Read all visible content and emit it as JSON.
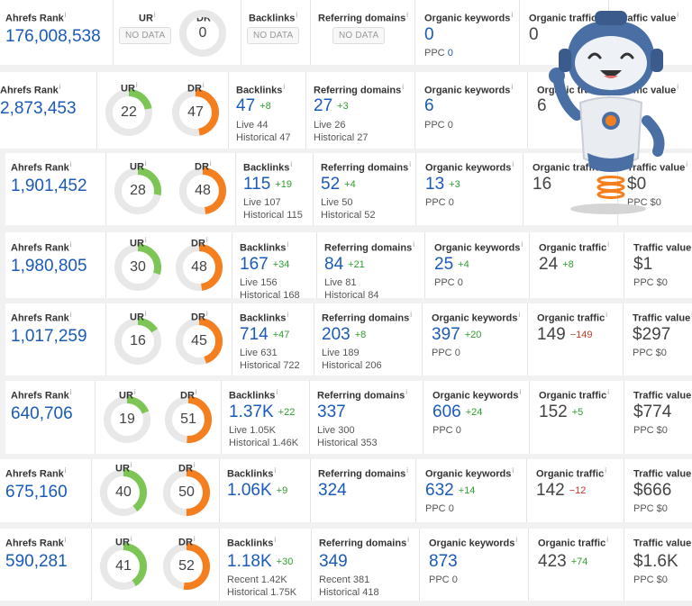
{
  "labels": {
    "ahrefs_rank": "Ahrefs Rank",
    "ur": "UR",
    "dr": "DR",
    "backlinks": "Backlinks",
    "referring_domains": "Referring domains",
    "organic_keywords": "Organic keywords",
    "organic_traffic": "Organic traffic",
    "traffic_value": "Traffic value",
    "info_mark": "i",
    "no_data": "NO DATA"
  },
  "colors": {
    "ur": "#7dc656",
    "dr": "#f57e1e",
    "track": "#e8e8e8",
    "link": "#1a5ab8",
    "positive": "#2e9e2e",
    "negative": "#c0392b"
  },
  "rows": [
    {
      "ahrefs_rank": "176,008,538",
      "ur": null,
      "dr": "0",
      "dr_value": 0,
      "backlinks": null,
      "backlinks_lines": [],
      "ref_domains": null,
      "ref_domains_lines": [],
      "organic_keywords": "0",
      "ppc": "0",
      "organic_traffic": "0",
      "traffic_value": null,
      "tv_ppc": null
    },
    {
      "ahrefs_rank": "2,873,453",
      "ur": "22",
      "ur_value": 22,
      "dr": "47",
      "dr_value": 47,
      "backlinks": "47",
      "backlinks_delta": "+8",
      "backlinks_lines": [
        "Live 44",
        "Historical 47"
      ],
      "ref_domains": "27",
      "ref_domains_delta": "+3",
      "ref_domains_lines": [
        "Live 26",
        "Historical 27"
      ],
      "organic_keywords": "6",
      "ppc": "0",
      "organic_traffic": "6",
      "traffic_value": null,
      "tv_ppc": null
    },
    {
      "ahrefs_rank": "1,901,452",
      "ur": "28",
      "ur_value": 28,
      "dr": "48",
      "dr_value": 48,
      "backlinks": "115",
      "backlinks_delta": "+19",
      "backlinks_lines": [
        "Live 107",
        "Historical 115"
      ],
      "ref_domains": "52",
      "ref_domains_delta": "+4",
      "ref_domains_lines": [
        "Live 50",
        "Historical 52"
      ],
      "organic_keywords": "13",
      "ok_delta": "+3",
      "ppc": "0",
      "organic_traffic": "16",
      "traffic_value": "$0",
      "tv_ppc": "$0"
    },
    {
      "ahrefs_rank": "1,980,805",
      "ur": "30",
      "ur_value": 30,
      "dr": "48",
      "dr_value": 48,
      "backlinks": "167",
      "backlinks_delta": "+34",
      "backlinks_lines": [
        "Live 156",
        "Historical 168"
      ],
      "ref_domains": "84",
      "ref_domains_delta": "+21",
      "ref_domains_lines": [
        "Live 81",
        "Historical 84"
      ],
      "organic_keywords": "25",
      "ok_delta": "+4",
      "ppc": "0",
      "organic_traffic": "24",
      "ot_delta": "+8",
      "ot_sign": "pos",
      "traffic_value": "$1",
      "tv_ppc": "$0"
    },
    {
      "ahrefs_rank": "1,017,259",
      "ur": "16",
      "ur_value": 16,
      "dr": "45",
      "dr_value": 45,
      "backlinks": "714",
      "backlinks_delta": "+47",
      "backlinks_lines": [
        "Live 631",
        "Historical 722"
      ],
      "ref_domains": "203",
      "ref_domains_delta": "+8",
      "ref_domains_lines": [
        "Live 189",
        "Historical 206"
      ],
      "organic_keywords": "397",
      "ok_delta": "+20",
      "ppc": "0",
      "organic_traffic": "149",
      "ot_delta": "−149",
      "ot_sign": "neg",
      "traffic_value": "$297",
      "tv_ppc": "$0"
    },
    {
      "ahrefs_rank": "640,706",
      "ur": "19",
      "ur_value": 19,
      "dr": "51",
      "dr_value": 51,
      "backlinks": "1.37K",
      "backlinks_delta": "+22",
      "backlinks_lines": [
        "Live 1.05K",
        "Historical 1.46K"
      ],
      "ref_domains": "337",
      "ref_domains_lines": [
        "Live 300",
        "Historical 353"
      ],
      "organic_keywords": "606",
      "ok_delta": "+24",
      "ppc": "0",
      "organic_traffic": "152",
      "ot_delta": "+5",
      "ot_sign": "pos",
      "traffic_value": "$774",
      "tv_ppc": "$0"
    },
    {
      "ahrefs_rank": "675,160",
      "ur": "40",
      "ur_value": 40,
      "dr": "50",
      "dr_value": 50,
      "backlinks": "1.06K",
      "backlinks_delta": "+9",
      "backlinks_lines": [],
      "ref_domains": "324",
      "ref_domains_lines": [],
      "organic_keywords": "632",
      "ok_delta": "+14",
      "ppc": "0",
      "organic_traffic": "142",
      "ot_delta": "−12",
      "ot_sign": "neg",
      "traffic_value": "$666",
      "tv_ppc": "$0"
    },
    {
      "ahrefs_rank": "590,281",
      "ur": "41",
      "ur_value": 41,
      "dr": "52",
      "dr_value": 52,
      "backlinks": "1.18K",
      "backlinks_delta": "+30",
      "backlinks_lines": [
        "Recent 1.42K",
        "Historical 1.75K"
      ],
      "ref_domains": "349",
      "ref_domains_lines": [
        "Recent 381",
        "Historical 418"
      ],
      "organic_keywords": "873",
      "ppc": "0",
      "organic_traffic": "423",
      "ot_delta": "+74",
      "ot_sign": "pos",
      "traffic_value": "$1.6K",
      "tv_ppc": "$0"
    }
  ]
}
